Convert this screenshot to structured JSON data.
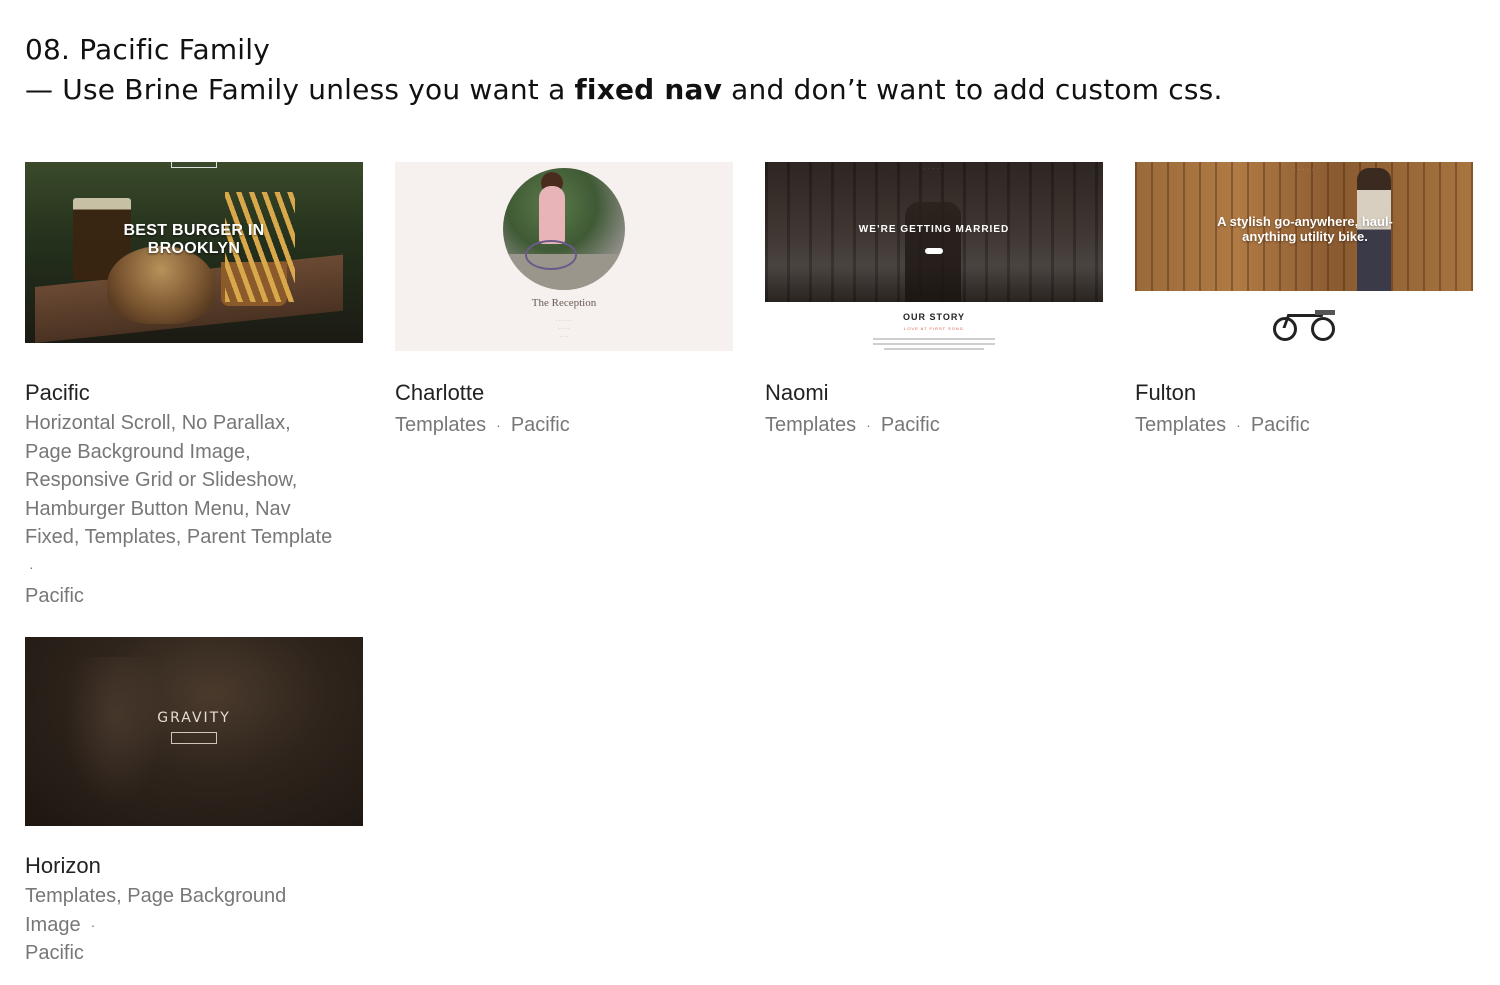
{
  "header": {
    "title": "08. Pacific Family",
    "note_prefix": " — Use Brine Family unless you want a ",
    "note_bold": "fixed nav",
    "note_suffix": " and don’t want to add custom css."
  },
  "cards": [
    {
      "name": "Pacific",
      "tags_line1": "Horizontal Scroll, No Parallax,",
      "tags_line2": "Page Background Image,",
      "tags_line3": "Responsive Grid or Slideshow,",
      "tags_line4": "Hamburger Button Menu, Nav",
      "tags_line5": "Fixed, Templates, Parent Template",
      "separator": "·",
      "family": "Pacific",
      "thumb_text": "BEST BURGER IN BROOKLYN"
    },
    {
      "name": "Charlotte",
      "tags": "Templates",
      "separator": "·",
      "family": "Pacific",
      "thumb_text": "The Reception"
    },
    {
      "name": "Naomi",
      "tags": "Templates",
      "separator": "·",
      "family": "Pacific",
      "thumb_text": "WE’RE GETTING MARRIED",
      "thumb_subtext": "OUR STORY",
      "thumb_tagline": "LOVE AT FIRST SONG"
    },
    {
      "name": "Fulton",
      "tags": "Templates",
      "separator": "·",
      "family": "Pacific",
      "thumb_text": "A stylish go-anywhere, haul-anything utility bike."
    },
    {
      "name": "Horizon",
      "tags_line1": "Templates, Page Background",
      "tags_line2": "Image",
      "separator": "·",
      "family": "Pacific",
      "thumb_text": "GRAVITY"
    }
  ]
}
